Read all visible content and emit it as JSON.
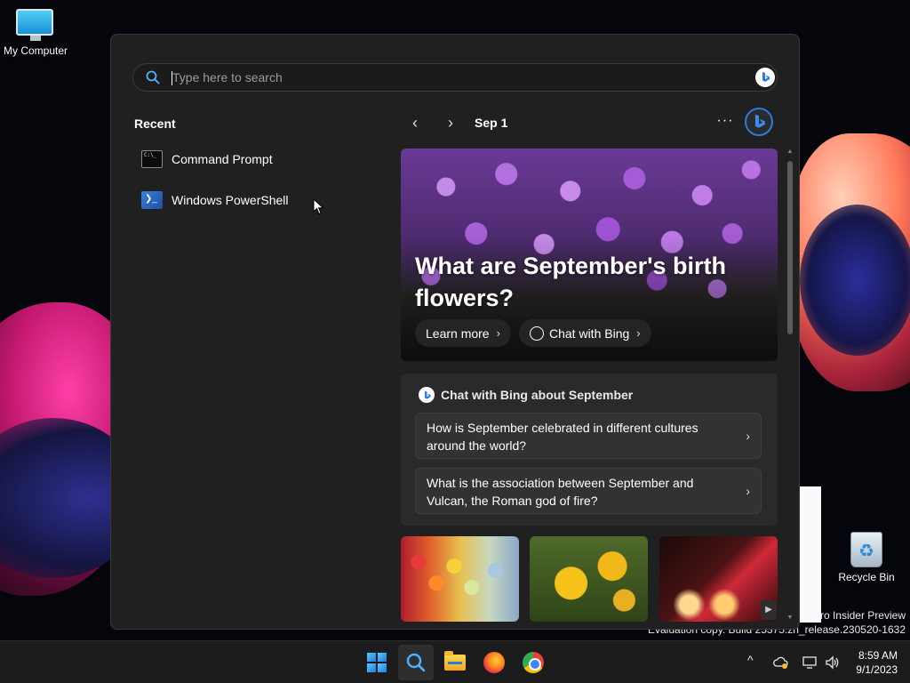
{
  "desktop": {
    "icons": [
      {
        "label": "My Computer"
      },
      {
        "label": "Recycle Bin"
      }
    ],
    "watermark_line1": "ro Insider Preview",
    "watermark_line2": "Evaluation copy. Build 25375.zn_release.230520-1632"
  },
  "search": {
    "placeholder": "Type here to search",
    "value": "",
    "bing_icon": "bing-icon"
  },
  "recent": {
    "title": "Recent",
    "items": [
      {
        "label": "Command Prompt",
        "icon": "command-prompt-icon"
      },
      {
        "label": "Windows PowerShell",
        "icon": "powershell-icon"
      }
    ]
  },
  "highlights": {
    "date": "Sep 1",
    "prev_icon": "chevron-left-icon",
    "next_icon": "chevron-right-icon",
    "more_label": "···",
    "hero": {
      "title": "What are September's birth flowers?",
      "learn_more": "Learn more",
      "chat_with_bing": "Chat with Bing"
    },
    "chat_card": {
      "title": "Chat with Bing about September",
      "questions": [
        "How is September celebrated in different cultures around the world?",
        "What is the association between September and Vulcan, the Roman god of fire?"
      ]
    }
  },
  "taskbar": {
    "apps": [
      "start",
      "search",
      "file-explorer",
      "firefox",
      "chrome"
    ],
    "tray": {
      "chevron": "^"
    },
    "time": "8:59 AM",
    "date": "9/1/2023"
  },
  "colors": {
    "panel_bg": "#202020",
    "card_bg": "#2a2a2a",
    "accent": "#2a7ae2",
    "taskbar_bg": "#1c1c1c"
  }
}
